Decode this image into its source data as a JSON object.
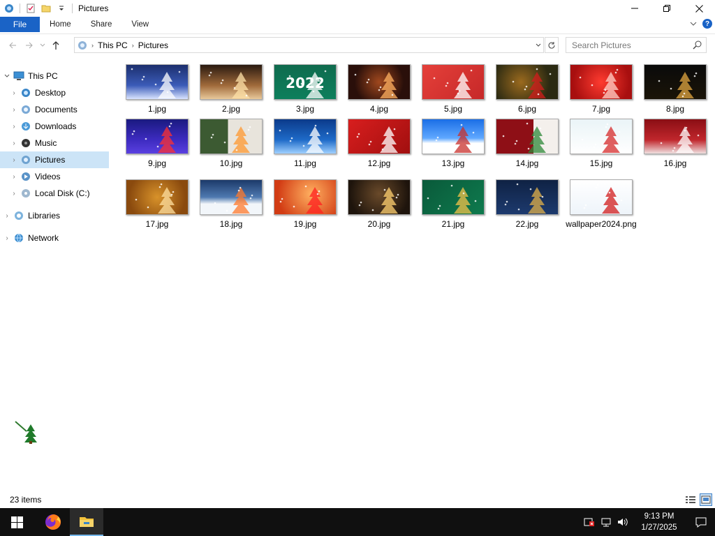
{
  "window": {
    "title": "Pictures"
  },
  "ribbon": {
    "file": "File",
    "tabs": [
      "Home",
      "Share",
      "View"
    ]
  },
  "address": {
    "crumbs": [
      "This PC",
      "Pictures"
    ],
    "search_placeholder": "Search Pictures"
  },
  "nav": {
    "items": [
      {
        "label": "This PC",
        "icon": "pc-icon",
        "level": 0,
        "expanded": true
      },
      {
        "label": "Desktop",
        "icon": "desktop-folder-icon",
        "level": 1
      },
      {
        "label": "Documents",
        "icon": "documents-folder-icon",
        "level": 1
      },
      {
        "label": "Downloads",
        "icon": "downloads-folder-icon",
        "level": 1
      },
      {
        "label": "Music",
        "icon": "music-folder-icon",
        "level": 1
      },
      {
        "label": "Pictures",
        "icon": "pictures-folder-icon",
        "level": 1,
        "selected": true
      },
      {
        "label": "Videos",
        "icon": "videos-folder-icon",
        "level": 1
      },
      {
        "label": "Local Disk (C:)",
        "icon": "disk-icon",
        "level": 1
      },
      {
        "label": "Libraries",
        "icon": "libraries-icon",
        "level": 0
      },
      {
        "label": "Network",
        "icon": "network-icon",
        "level": 0
      }
    ]
  },
  "files": [
    {
      "name": "1.jpg",
      "bg": "linear-gradient(180deg,#1c2f6e,#3b5bb8 60%,#d9e4ff)",
      "accent": "#ffffff"
    },
    {
      "name": "2.jpg",
      "bg": "linear-gradient(180deg,#2a1a10,#a06a3a 60%,#e8c89a)",
      "accent": "#ffe2a8"
    },
    {
      "name": "3.jpg",
      "bg": "linear-gradient(180deg,#0f6b4e,#0d7f5c)",
      "accent": "#ffffff",
      "caption": "2022"
    },
    {
      "name": "4.jpg",
      "bg": "radial-gradient(circle at 50% 50%,#a0481e,#2a0f0a 70%)",
      "accent": "#ffb060"
    },
    {
      "name": "5.jpg",
      "bg": "linear-gradient(135deg,#e5403a,#c62828)",
      "accent": "#ffffff"
    },
    {
      "name": "6.jpg",
      "bg": "radial-gradient(circle at 40% 50%,#9b6a1e,#2b2a12 70%)",
      "accent": "#d21c1c"
    },
    {
      "name": "7.jpg",
      "bg": "radial-gradient(circle at 50% 50%,#ff3b30,#a80f0f 80%)",
      "accent": "#ffd0c8"
    },
    {
      "name": "8.jpg",
      "bg": "linear-gradient(180deg,#0a0a0a,#1a1408)",
      "accent": "#e0a640"
    },
    {
      "name": "9.jpg",
      "bg": "linear-gradient(180deg,#1a1a80,#3d2bc0 60%,#5a40e0)",
      "accent": "#ff3030"
    },
    {
      "name": "10.jpg",
      "bg": "linear-gradient(90deg,#3c5a32 45%,#e8e4dc 45%)",
      "accent": "#ff9830"
    },
    {
      "name": "11.jpg",
      "bg": "linear-gradient(180deg,#0b3a8a,#1e6ac8 60%,#9fd0ff)",
      "accent": "#ffffff"
    },
    {
      "name": "12.jpg",
      "bg": "linear-gradient(135deg,#d81e1e,#a10f0f)",
      "accent": "#ffffff"
    },
    {
      "name": "13.jpg",
      "bg": "linear-gradient(180deg,#1b6ee6,#5fa8ff 55%,#ffffff 70%)",
      "accent": "#c8302c"
    },
    {
      "name": "14.jpg",
      "bg": "linear-gradient(90deg,#8e0f16 60%,#f4f0ec 60%)",
      "accent": "#2f8a3a"
    },
    {
      "name": "15.jpg",
      "bg": "linear-gradient(180deg,#eaf4f7,#ffffff)",
      "accent": "#d62b2b"
    },
    {
      "name": "16.jpg",
      "bg": "linear-gradient(180deg,#8a0e14,#c0262c 60%,#f0e0e0)",
      "accent": "#ffffff"
    },
    {
      "name": "17.jpg",
      "bg": "radial-gradient(circle at 50% 50%,#d8922a,#8a4a0e 80%)",
      "accent": "#ffe0a0"
    },
    {
      "name": "18.jpg",
      "bg": "linear-gradient(180deg,#1c3a6a,#4e79b0 50%,#f2f6fa 70%)",
      "accent": "#ff7a2c"
    },
    {
      "name": "19.jpg",
      "bg": "radial-gradient(circle at 60% 40%,#ffb060,#d23c14 80%)",
      "accent": "#ff2020"
    },
    {
      "name": "20.jpg",
      "bg": "radial-gradient(circle at 50% 40%,#6a4a2a,#1e140c 80%)",
      "accent": "#ffd070"
    },
    {
      "name": "21.jpg",
      "bg": "linear-gradient(135deg,#0a5a3a,#0e7a4e)",
      "accent": "#f0c24a"
    },
    {
      "name": "22.jpg",
      "bg": "linear-gradient(180deg,#0f2244,#1d3a6e)",
      "accent": "#e0b04a"
    },
    {
      "name": "wallpaper2024.png",
      "bg": "linear-gradient(180deg,#ffffff,#eef4fa)",
      "accent": "#d21c1c"
    }
  ],
  "status": {
    "count": "23 items"
  },
  "taskbar": {
    "time": "9:13 PM",
    "date": "1/27/2025"
  }
}
